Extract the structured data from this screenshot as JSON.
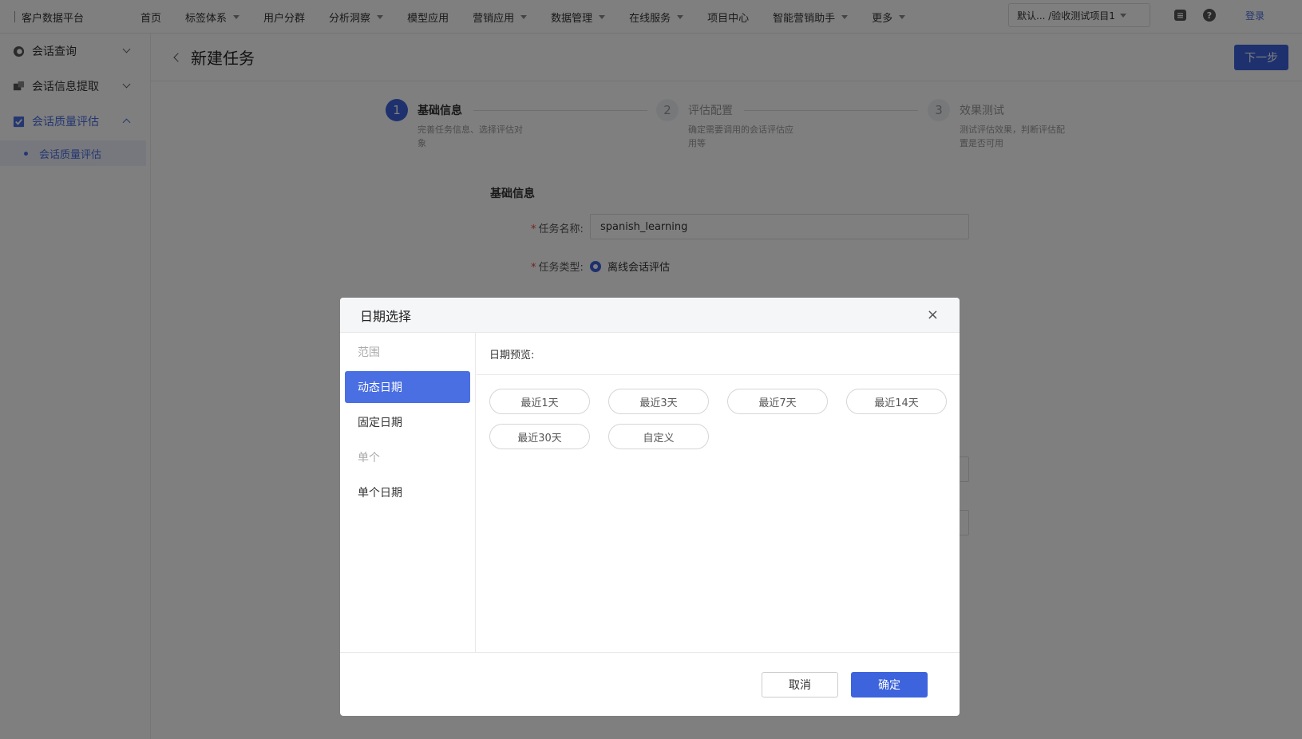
{
  "topnav": {
    "brand": "客户数据平台",
    "items": [
      {
        "label": "首页",
        "dropdown": false
      },
      {
        "label": "标签体系",
        "dropdown": true
      },
      {
        "label": "用户分群",
        "dropdown": false
      },
      {
        "label": "分析洞察",
        "dropdown": true
      },
      {
        "label": "模型应用",
        "dropdown": false
      },
      {
        "label": "营销应用",
        "dropdown": true
      },
      {
        "label": "数据管理",
        "dropdown": true
      },
      {
        "label": "在线服务",
        "dropdown": true
      },
      {
        "label": "项目中心",
        "dropdown": false
      },
      {
        "label": "智能营销助手",
        "dropdown": true
      },
      {
        "label": "更多",
        "dropdown": true
      }
    ],
    "project": "默认...  /验收测试项目1",
    "login": "登录"
  },
  "sidebar": {
    "items": [
      {
        "label": "会话查询"
      },
      {
        "label": "会话信息提取"
      },
      {
        "label": "会话质量评估"
      }
    ],
    "sub_item": "会话质量评估"
  },
  "page": {
    "title": "新建任务",
    "next_button": "下一步",
    "steps": [
      {
        "num": "1",
        "title": "基础信息",
        "desc": "完善任务信息、选择评估对象"
      },
      {
        "num": "2",
        "title": "评估配置",
        "desc": "确定需要调用的会话评估应用等"
      },
      {
        "num": "3",
        "title": "效果测试",
        "desc": "测试评估效果，判断评估配置是否可用"
      }
    ],
    "section_title": "基础信息",
    "task_name_label": "任务名称:",
    "task_name_value": "spanish_learning",
    "task_type_label": "任务类型:",
    "task_type_value": "离线会话评估"
  },
  "modal": {
    "title": "日期选择",
    "close": "×",
    "left_options": {
      "group_range": "范围",
      "dynamic": "动态日期",
      "fixed": "固定日期",
      "group_single": "单个",
      "single": "单个日期"
    },
    "preview_label": "日期预览:",
    "quick_buttons": [
      "最近1天",
      "最近3天",
      "最近7天",
      "最近14天",
      "最近30天",
      "自定义"
    ],
    "cancel": "取消",
    "ok": "确定"
  },
  "colors": {
    "primary": "#3d63dd",
    "selected_bg": "#4a6fe3"
  }
}
